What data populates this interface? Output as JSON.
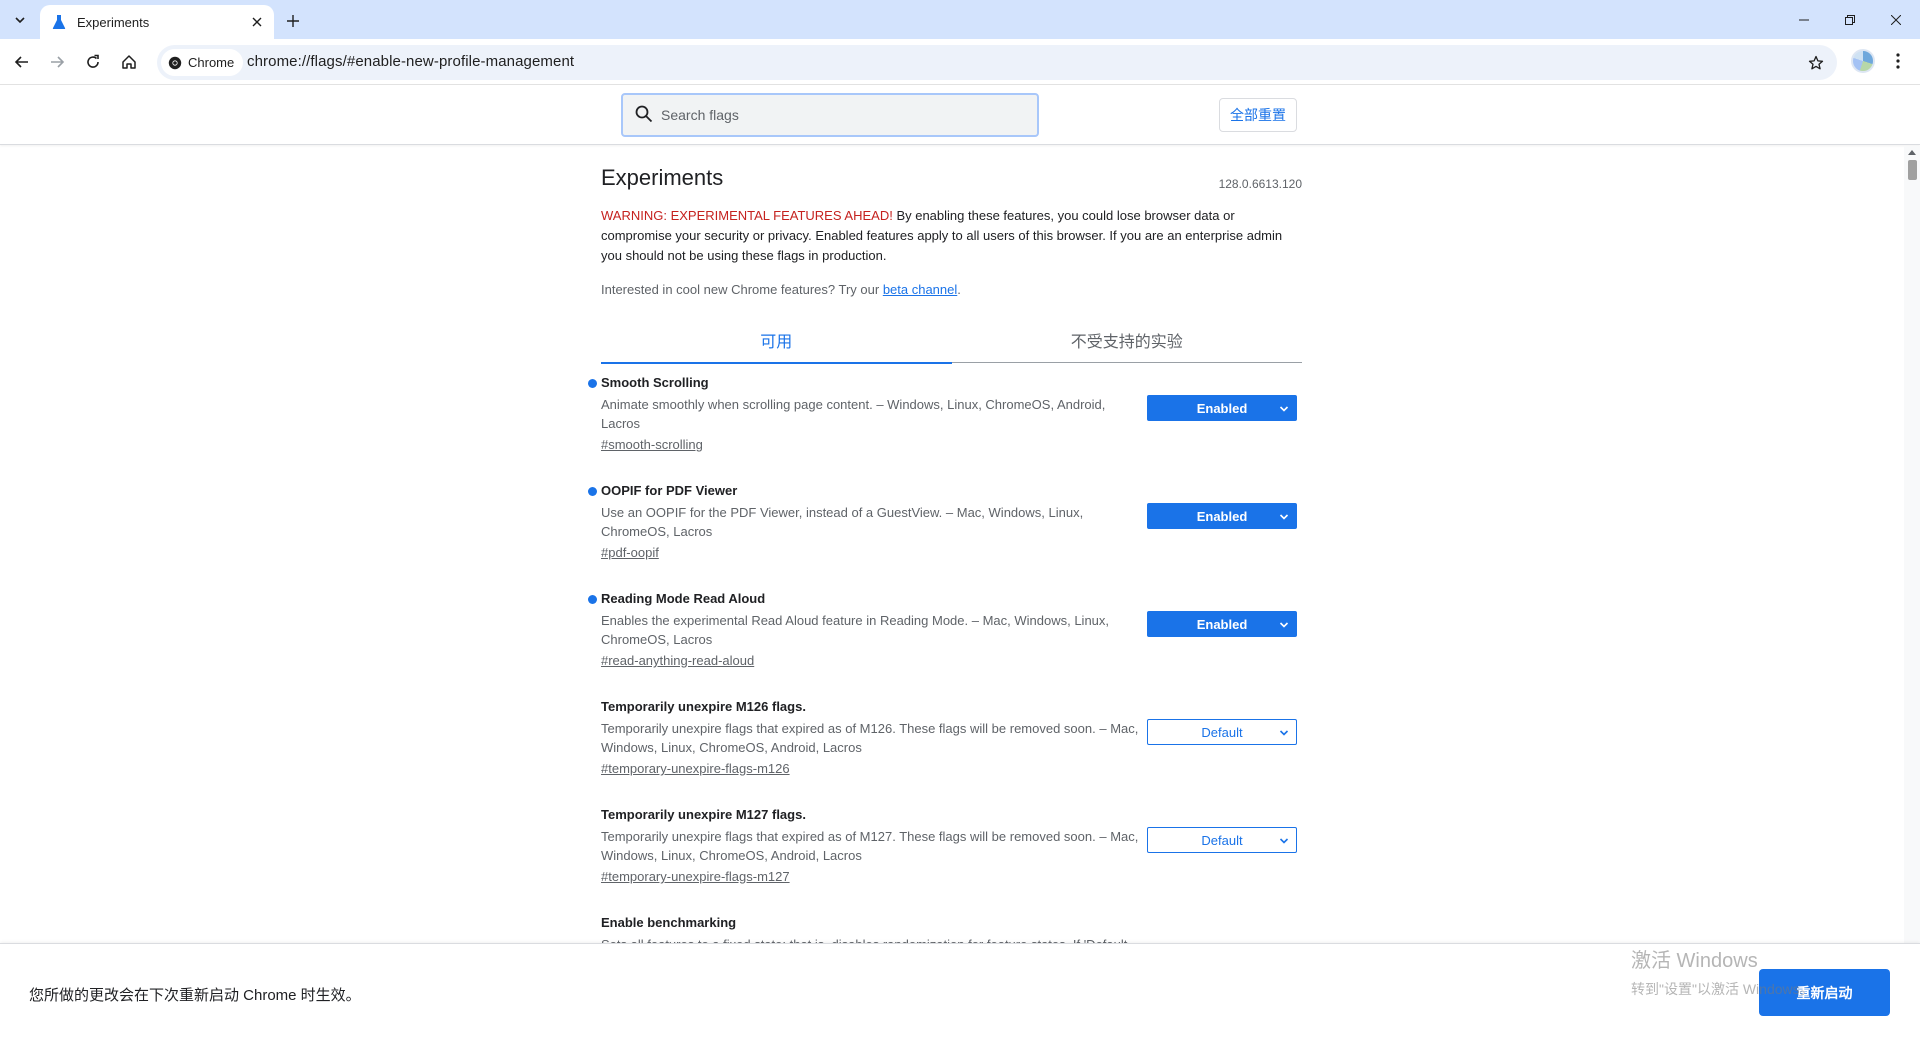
{
  "browser": {
    "tab_title": "Experiments",
    "chip_label": "Chrome",
    "url": "chrome://flags/#enable-new-profile-management"
  },
  "flags_header": {
    "search_placeholder": "Search flags",
    "reset_all_label": "全部重置"
  },
  "page": {
    "title": "Experiments",
    "version": "128.0.6613.120",
    "warning_prefix": "WARNING: EXPERIMENTAL FEATURES AHEAD!",
    "warning_text": " By enabling these features, you could lose browser data or compromise your security or privacy. Enabled features apply to all users of this browser. If you are an enterprise admin you should not be using these flags in production.",
    "interested_text": "Interested in cool new Chrome features? Try our ",
    "beta_link": "beta channel",
    "interested_suffix": ".",
    "tabs": [
      {
        "label": "可用",
        "active": true
      },
      {
        "label": "不受支持的实验",
        "active": false
      }
    ]
  },
  "experiments": [
    {
      "name": "Smooth Scrolling",
      "description": "Animate smoothly when scrolling page content. – Windows, Linux, ChromeOS, Android, Lacros",
      "link": "#smooth-scrolling",
      "value": "Enabled",
      "modified": true
    },
    {
      "name": "OOPIF for PDF Viewer",
      "description": "Use an OOPIF for the PDF Viewer, instead of a GuestView. – Mac, Windows, Linux, ChromeOS, Lacros",
      "link": "#pdf-oopif",
      "value": "Enabled",
      "modified": true
    },
    {
      "name": "Reading Mode Read Aloud",
      "description": "Enables the experimental Read Aloud feature in Reading Mode. – Mac, Windows, Linux, ChromeOS, Lacros",
      "link": "#read-anything-read-aloud",
      "value": "Enabled",
      "modified": true
    },
    {
      "name": "Temporarily unexpire M126 flags.",
      "description": "Temporarily unexpire flags that expired as of M126. These flags will be removed soon. – Mac, Windows, Linux, ChromeOS, Android, Lacros",
      "link": "#temporary-unexpire-flags-m126",
      "value": "Default",
      "modified": false
    },
    {
      "name": "Temporarily unexpire M127 flags.",
      "description": "Temporarily unexpire flags that expired as of M127. These flags will be removed soon. – Mac, Windows, Linux, ChromeOS, Android, Lacros",
      "link": "#temporary-unexpire-flags-m127",
      "value": "Default",
      "modified": false
    },
    {
      "name": "Enable benchmarking",
      "description": "Sets all features to a fixed state; that is, disables randomization for feature states. If 'Default",
      "link": "",
      "value": "",
      "modified": false
    }
  ],
  "relaunch_bar": {
    "message": "您所做的更改会在下次重新启动 Chrome 时生效。",
    "button_label": "重新启动"
  },
  "watermark": {
    "line1": "激活 Windows",
    "line2": "转到\"设置\"以激活 Windows。"
  },
  "colors": {
    "accent": "#1a73e8",
    "warning": "#c5221f",
    "tabstrip": "#d3e3fd"
  }
}
